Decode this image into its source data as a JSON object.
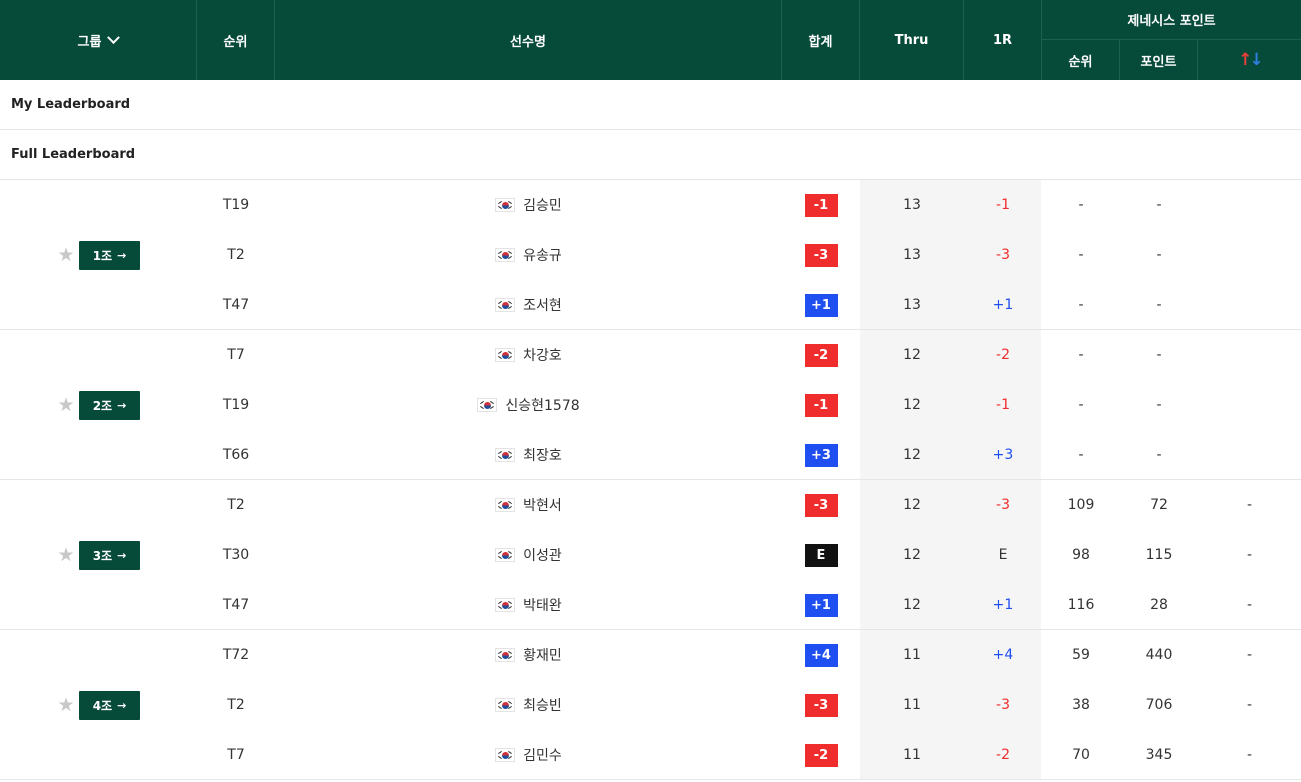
{
  "header": {
    "group_label": "그룹",
    "rank_label": "순위",
    "player_label": "선수명",
    "total_label": "합계",
    "thru_label": "Thru",
    "round_label": "1R",
    "genesis_label": "제네시스 포인트",
    "genesis_rank_label": "순위",
    "genesis_points_label": "포인트",
    "sort_icon_up": "↑",
    "sort_icon_down": "↓"
  },
  "sections": {
    "my_leaderboard": "My Leaderboard",
    "full_leaderboard": "Full Leaderboard"
  },
  "colors": {
    "header_bg": "#064a3a",
    "under_par": "#f02d2d",
    "over_par": "#1f4ff0",
    "even_par": "#111111"
  },
  "groups": [
    {
      "label": "1조",
      "arrow": "→",
      "players": [
        {
          "rank": "T19",
          "name": "김승민",
          "total": "-1",
          "thru": "13",
          "r1": "-1",
          "g_rank": "-",
          "g_points": "-",
          "extra": "",
          "type": "red"
        },
        {
          "rank": "T2",
          "name": "유송규",
          "total": "-3",
          "thru": "13",
          "r1": "-3",
          "g_rank": "-",
          "g_points": "-",
          "extra": "",
          "type": "red"
        },
        {
          "rank": "T47",
          "name": "조서현",
          "total": "+1",
          "thru": "13",
          "r1": "+1",
          "g_rank": "-",
          "g_points": "-",
          "extra": "",
          "type": "blue"
        }
      ]
    },
    {
      "label": "2조",
      "arrow": "→",
      "players": [
        {
          "rank": "T7",
          "name": "차강호",
          "total": "-2",
          "thru": "12",
          "r1": "-2",
          "g_rank": "-",
          "g_points": "-",
          "extra": "",
          "type": "red"
        },
        {
          "rank": "T19",
          "name": "신승현1578",
          "total": "-1",
          "thru": "12",
          "r1": "-1",
          "g_rank": "-",
          "g_points": "-",
          "extra": "",
          "type": "red"
        },
        {
          "rank": "T66",
          "name": "최장호",
          "total": "+3",
          "thru": "12",
          "r1": "+3",
          "g_rank": "-",
          "g_points": "-",
          "extra": "",
          "type": "blue"
        }
      ]
    },
    {
      "label": "3조",
      "arrow": "→",
      "players": [
        {
          "rank": "T2",
          "name": "박현서",
          "total": "-3",
          "thru": "12",
          "r1": "-3",
          "g_rank": "109",
          "g_points": "72",
          "extra": "-",
          "type": "red"
        },
        {
          "rank": "T30",
          "name": "이성관",
          "total": "E",
          "thru": "12",
          "r1": "E",
          "g_rank": "98",
          "g_points": "115",
          "extra": "-",
          "type": "black"
        },
        {
          "rank": "T47",
          "name": "박태완",
          "total": "+1",
          "thru": "12",
          "r1": "+1",
          "g_rank": "116",
          "g_points": "28",
          "extra": "-",
          "type": "blue"
        }
      ]
    },
    {
      "label": "4조",
      "arrow": "→",
      "players": [
        {
          "rank": "T72",
          "name": "황재민",
          "total": "+4",
          "thru": "11",
          "r1": "+4",
          "g_rank": "59",
          "g_points": "440",
          "extra": "-",
          "type": "blue"
        },
        {
          "rank": "T2",
          "name": "최승빈",
          "total": "-3",
          "thru": "11",
          "r1": "-3",
          "g_rank": "38",
          "g_points": "706",
          "extra": "-",
          "type": "red"
        },
        {
          "rank": "T7",
          "name": "김민수",
          "total": "-2",
          "thru": "11",
          "r1": "-2",
          "g_rank": "70",
          "g_points": "345",
          "extra": "-",
          "type": "red"
        }
      ]
    }
  ]
}
